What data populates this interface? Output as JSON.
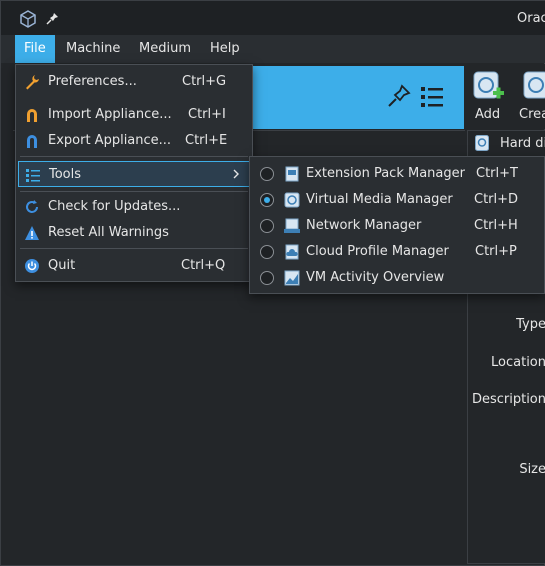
{
  "window": {
    "title": "Orac"
  },
  "menubar": [
    "File",
    "Machine",
    "Medium",
    "Help"
  ],
  "toolbar": {
    "add_label": "Add",
    "create_label": "Crea"
  },
  "details": {
    "hard_disk_tab": "Hard di",
    "fields": [
      "Type",
      "Location",
      "Description",
      "Size"
    ]
  },
  "file_menu": {
    "items": [
      {
        "label": "Preferences...",
        "shortcut": "Ctrl+G"
      },
      {
        "label": "Import Appliance...",
        "shortcut": "Ctrl+I"
      },
      {
        "label": "Export Appliance...",
        "shortcut": "Ctrl+E"
      },
      {
        "label": "Tools",
        "shortcut": ""
      },
      {
        "label": "Check for Updates...",
        "shortcut": ""
      },
      {
        "label": "Reset All Warnings",
        "shortcut": ""
      },
      {
        "label": "Quit",
        "shortcut": "Ctrl+Q"
      }
    ]
  },
  "tools_menu": {
    "items": [
      {
        "label": "Extension Pack Manager",
        "shortcut": "Ctrl+T",
        "selected": false
      },
      {
        "label": "Virtual Media Manager",
        "shortcut": "Ctrl+D",
        "selected": true
      },
      {
        "label": "Network Manager",
        "shortcut": "Ctrl+H",
        "selected": false
      },
      {
        "label": "Cloud Profile Manager",
        "shortcut": "Ctrl+P",
        "selected": false
      },
      {
        "label": "VM Activity Overview",
        "shortcut": "",
        "selected": false
      }
    ]
  },
  "colors": {
    "accent": "#3daee9",
    "background": "#232629",
    "menu_bg": "#2a2e32"
  }
}
